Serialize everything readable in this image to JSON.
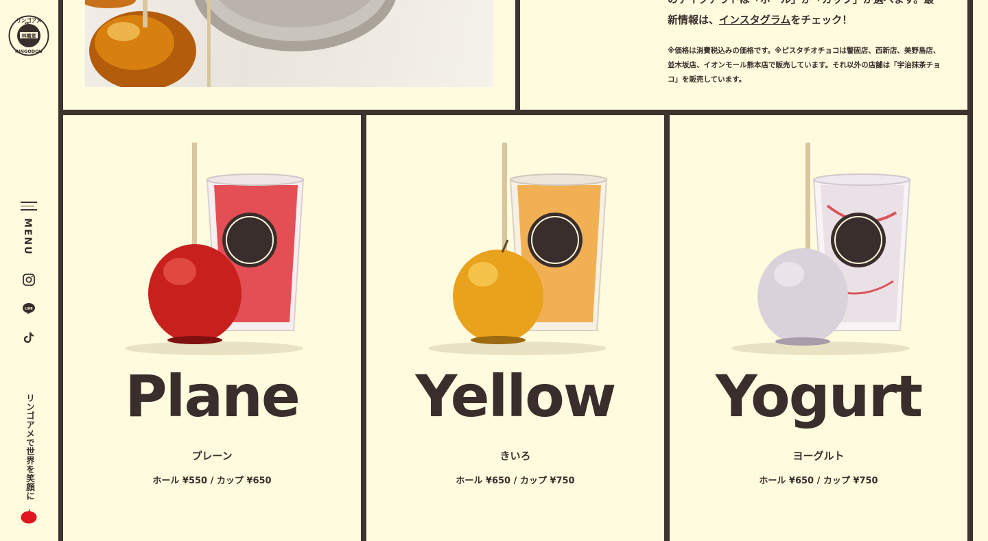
{
  "brand": {
    "logo_text_top": "リンゴアメ",
    "logo_text_middle": "林檎堂",
    "logo_text_bottom": "RINGODOU"
  },
  "sidebar": {
    "menu_label": "MENU",
    "social_icons": [
      "instagram-icon",
      "line-icon",
      "tiktok-icon"
    ],
    "tagline": "リンゴアメで世界を笑顔に"
  },
  "info": {
    "line1": "のテイクアウトは「ホール」か「カップ」か選べます。最",
    "line2_prefix": "新情報は、",
    "line2_link": "インスタグラム",
    "line2_suffix": "をチェック！",
    "note": "※価格は消費税込みの価格です。※ピスタチオチョコは警固店、西新店、美野島店、並木坂店、イオンモール熊本店で販売しています。それ以外の店舗は「宇治抹茶チョコ」を販売しています。"
  },
  "products": [
    {
      "name": "Plane",
      "name_jp": "プレーン",
      "price": "ホール ¥550 / カップ ¥650",
      "apple_color": "#c8201d",
      "fill_color": "#e0333a"
    },
    {
      "name": "Yellow",
      "name_jp": "きいろ",
      "price": "ホール ¥650 / カップ ¥750",
      "apple_color": "#e9a21c",
      "fill_color": "#f0a53a"
    },
    {
      "name": "Yogurt",
      "name_jp": "ヨーグルト",
      "price": "ホール ¥650 / カップ ¥750",
      "apple_color": "#d9d2da",
      "fill_color": "#e8dfe4"
    }
  ],
  "colors": {
    "background": "#fffbde",
    "frame": "#3d3330",
    "text": "#3a2e2c",
    "accent_red": "#e0141e"
  }
}
